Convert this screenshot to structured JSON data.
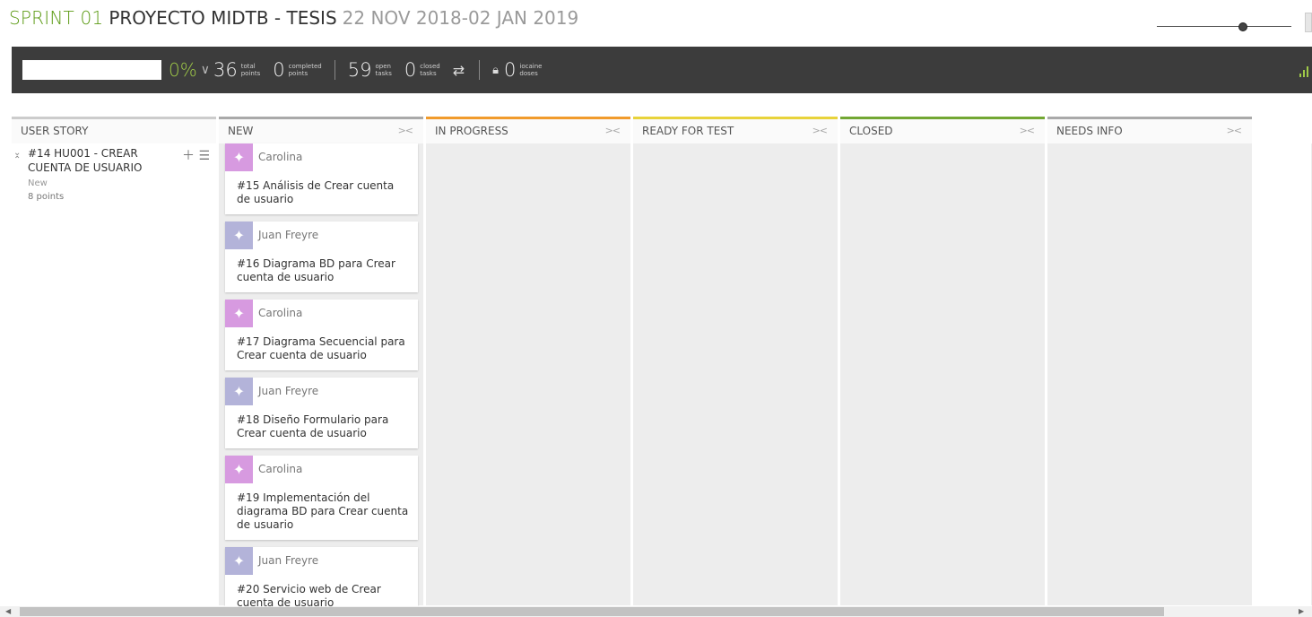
{
  "header": {
    "sprint": "SPRINT 01",
    "project": "PROYECTO MIDTB - TESIS",
    "dates": "22 NOV 2018-02 JAN 2019"
  },
  "summary": {
    "progress_percent": "0%",
    "progress_fraction": 0,
    "total_points": "36",
    "total_label_1": "total",
    "total_label_2": "points",
    "completed_points": "0",
    "completed_label_1": "completed",
    "completed_label_2": "points",
    "open_tasks": "59",
    "open_label_1": "open",
    "open_label_2": "tasks",
    "closed_tasks": "0",
    "closed_label_1": "closed",
    "closed_label_2": "tasks",
    "iocaine_doses": "0",
    "iocaine_label_1": "iocaine",
    "iocaine_label_2": "doses"
  },
  "columns": [
    {
      "label": "USER STORY",
      "color": "#cccccc"
    },
    {
      "label": "NEW",
      "color": "#a9a9a9",
      "collapse": "><"
    },
    {
      "label": "IN PROGRESS",
      "color": "#f19b2c",
      "collapse": "><"
    },
    {
      "label": "READY FOR TEST",
      "color": "#e8d33b",
      "collapse": "><"
    },
    {
      "label": "CLOSED",
      "color": "#72a733",
      "collapse": "><"
    },
    {
      "label": "NEEDS INFO",
      "color": "#a9a9a9",
      "collapse": "><"
    }
  ],
  "user_story": {
    "title": "#14 HU001 - CREAR CUENTA DE USUARIO",
    "status": "New",
    "points": "8 points"
  },
  "cards": [
    {
      "assignee": "Carolina",
      "task": "#15 Análisis de Crear cuenta de usuario",
      "avatar_color": "#d79ae0"
    },
    {
      "assignee": "Juan Freyre",
      "task": "#16 Diagrama BD para Crear cuenta de usuario",
      "avatar_color": "#b3b3d9"
    },
    {
      "assignee": "Carolina",
      "task": "#17 Diagrama Secuencial para Crear cuenta de usuario",
      "avatar_color": "#d79ae0"
    },
    {
      "assignee": "Juan Freyre",
      "task": "#18 Diseño Formulario para Crear cuenta de usuario",
      "avatar_color": "#b3b3d9"
    },
    {
      "assignee": "Carolina",
      "task": "#19 Implementación del diagrama BD para Crear cuenta de usuario",
      "avatar_color": "#d79ae0"
    },
    {
      "assignee": "Juan Freyre",
      "task": "#20 Servicio web de Crear cuenta de usuario",
      "avatar_color": "#b3b3d9"
    }
  ]
}
